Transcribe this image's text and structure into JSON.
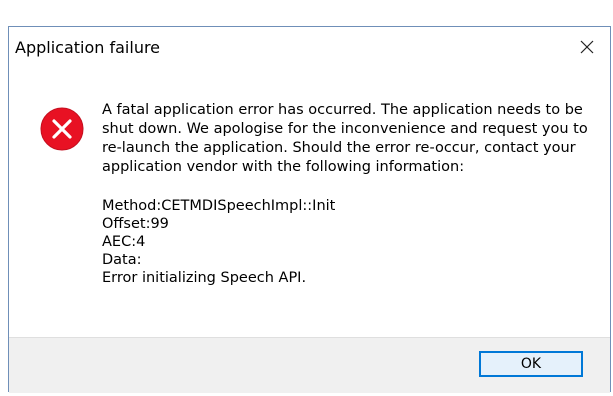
{
  "window": {
    "title": "Application failure"
  },
  "icons": {
    "close": "close-icon",
    "error": "error-icon"
  },
  "colors": {
    "error_red": "#e81123",
    "accent_blue": "#0078d7",
    "footer_bg": "#f0f0f0"
  },
  "message": {
    "text": "A fatal application error has occurred. The application needs to be shut down. We apologise for the inconvenience and request you to re-launch the application. Should the error re-occur, contact your application vendor with the following information:"
  },
  "details": {
    "method": "Method:CETMDISpeechImpl::Init",
    "offset": "Offset:99",
    "aec": "AEC:4",
    "data": "Data:",
    "error": "Error initializing Speech API."
  },
  "footer": {
    "ok_label": "OK"
  }
}
